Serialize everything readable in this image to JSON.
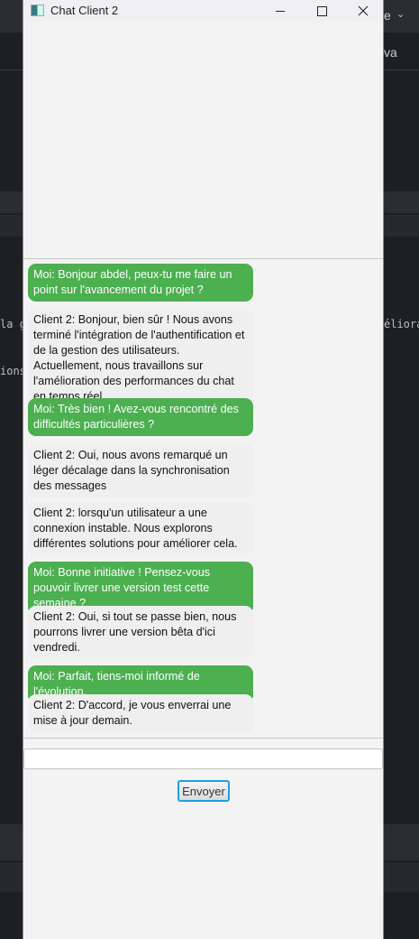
{
  "window": {
    "title": "Chat Client 2",
    "icons": [
      "app-icon",
      "minimize-icon",
      "maximize-icon",
      "close-icon"
    ]
  },
  "background_ide": {
    "fragments": [
      "e",
      "va",
      "la g",
      "ions",
      "éliorat"
    ]
  },
  "colors": {
    "my_bubble": "#4caf50",
    "other_bubble": "#efefef",
    "focus_border": "#1ea0dc"
  },
  "messages": [
    {
      "sender": "me",
      "text": "Moi: Bonjour abdel, peux-tu me faire un point sur l'avancement du projet ?"
    },
    {
      "sender": "other",
      "text": "Client 2: Bonjour, bien sûr ! Nous avons terminé l'intégration de l'authentification et de la gestion des utilisateurs. Actuellement, nous travaillons sur l'amélioration des performances du chat en temps réel."
    },
    {
      "sender": "me",
      "text": "Moi: Très bien ! Avez-vous rencontré des difficultés particulières ?"
    },
    {
      "sender": "other",
      "text": "Client 2:  Oui, nous avons remarqué un léger décalage dans la synchronisation des messages"
    },
    {
      "sender": "other",
      "text": "Client 2: lorsqu'un utilisateur a une connexion instable. Nous explorons différentes solutions pour améliorer cela."
    },
    {
      "sender": "me",
      "text": "Moi: Bonne initiative ! Pensez-vous pouvoir livrer une version test cette semaine ?"
    },
    {
      "sender": "other",
      "text": "Client 2: Oui, si tout se passe bien, nous pourrons livrer une version bêta d'ici vendredi."
    },
    {
      "sender": "me",
      "text": "Moi: Parfait, tiens-moi informé de l'évolution."
    },
    {
      "sender": "other",
      "text": "Client 2: D'accord, je vous enverrai une mise à jour demain."
    }
  ],
  "composer": {
    "value": "",
    "send_label": "Envoyer"
  }
}
